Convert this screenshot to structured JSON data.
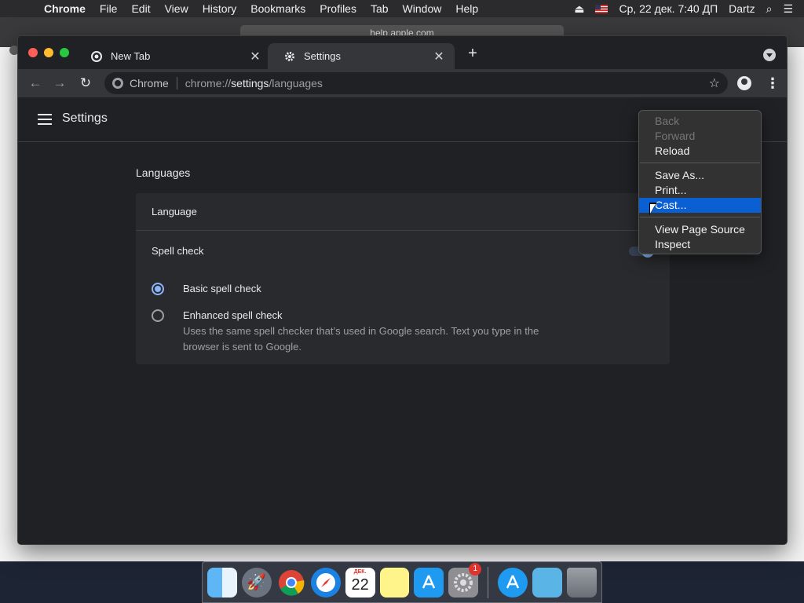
{
  "menubar": {
    "app": "Chrome",
    "items": [
      "File",
      "Edit",
      "View",
      "History",
      "Bookmarks",
      "Profiles",
      "Tab",
      "Window",
      "Help"
    ],
    "datetime": "Ср, 22 дек.  7:40 ДП",
    "user": "Dartz"
  },
  "background_window": {
    "url": "help.apple.com"
  },
  "tabs": [
    {
      "label": "New Tab",
      "icon": "chrome-icon",
      "active": false
    },
    {
      "label": "Settings",
      "icon": "gear-icon",
      "active": true
    }
  ],
  "omnibox": {
    "chip": "Chrome",
    "url_prefix": "chrome://",
    "url_host": "settings",
    "url_path": "/languages"
  },
  "settings": {
    "title": "Settings",
    "section_title": "Languages",
    "language_row": "Language",
    "spell_check": "Spell check",
    "spell_check_enabled": true,
    "options": [
      {
        "label": "Basic spell check",
        "selected": true
      },
      {
        "label": "Enhanced spell check",
        "selected": false,
        "description": "Uses the same spell checker that’s used in Google search. Text you type in the browser is sent to Google."
      }
    ]
  },
  "context_menu": {
    "groups": [
      [
        {
          "label": "Back",
          "enabled": false
        },
        {
          "label": "Forward",
          "enabled": false
        },
        {
          "label": "Reload",
          "enabled": true
        }
      ],
      [
        {
          "label": "Save As...",
          "enabled": true
        },
        {
          "label": "Print...",
          "enabled": true
        },
        {
          "label": "Cast...",
          "enabled": true,
          "highlighted": true
        }
      ],
      [
        {
          "label": "View Page Source",
          "enabled": true
        },
        {
          "label": "Inspect",
          "enabled": true
        }
      ]
    ]
  },
  "dock": {
    "apps": [
      "finder",
      "launchpad",
      "chrome",
      "safari",
      "calendar",
      "notes",
      "app-store",
      "system-preferences"
    ],
    "calendar": {
      "month": "ДЕК.",
      "day": "22"
    },
    "system_preferences_badge": "1",
    "extras": [
      "app-store-downloads",
      "downloads-folder",
      "trash"
    ]
  },
  "colors": {
    "accent": "#8ab4f8",
    "menu_highlight": "#0a5fd3",
    "page_bg": "#202124"
  }
}
